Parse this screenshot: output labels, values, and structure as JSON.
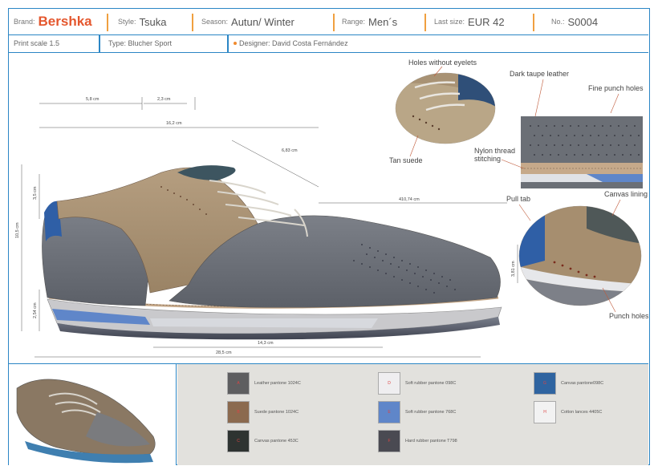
{
  "header": {
    "brand_label": "Brand:",
    "brand": "Bershka",
    "style_label": "Style:",
    "style": "Tsuka",
    "season_label": "Season:",
    "season": "Autun/ Winter",
    "range_label": "Range:",
    "range": "Men´s",
    "last_size_label": "Last size:",
    "last_size": "EUR 42",
    "no_label": "No.:",
    "no": "S0004"
  },
  "subheader": {
    "print_scale": "Print scale 1.5",
    "type": "Type: Blucher Sport",
    "designer": "Designer: David Costa Fernández"
  },
  "dimensions": {
    "d1": "5,8 cm",
    "d2": "2,3 cm",
    "d3": "16,2 cm",
    "d4": "6,83 cm",
    "d5": "410,74 cm",
    "d6": "3,5 cm",
    "d7": "10,5 cm",
    "d8": "2,54 cm",
    "d9": "14,3 cm",
    "d10": "28,5 cm",
    "d11": "3,81 cm"
  },
  "callouts": {
    "holes": "Holes without eyelets",
    "tan_suede": "Tan suede",
    "dark_taupe": "Dark taupe leather",
    "fine_punch": "Fine punch holes",
    "nylon1": "Nylon thread",
    "nylon2": "stitching",
    "pull_tab": "Pull tab",
    "canvas_lining": "Canvas lining",
    "punch_holes": "Punch holes"
  },
  "swatches": [
    {
      "code": "A",
      "label": "Leather pantone 1024C",
      "color": "#5e5e60"
    },
    {
      "code": "B",
      "label": "Suede pantone 1024C",
      "color": "#8b6a4f"
    },
    {
      "code": "C",
      "label": "Canvas  pantone 453C",
      "color": "#2e3331"
    },
    {
      "code": "D",
      "label": "Soft rubber pantone 098C",
      "color": "#efeef0"
    },
    {
      "code": "E",
      "label": "Soft rubber pantone 768C",
      "color": "#5f86c9"
    },
    {
      "code": "F",
      "label": "Hard rubber pantone T798",
      "color": "#4a4a52"
    },
    {
      "code": "G",
      "label": "Canvas pantone098C",
      "color": "#2f64a0"
    },
    {
      "code": "H",
      "label": "Cotton lances  4405C",
      "color": "#f2f2f2"
    }
  ],
  "colors": {
    "border": "#2b86c5",
    "brand": "#e4572e",
    "separator": "#f0a040"
  }
}
